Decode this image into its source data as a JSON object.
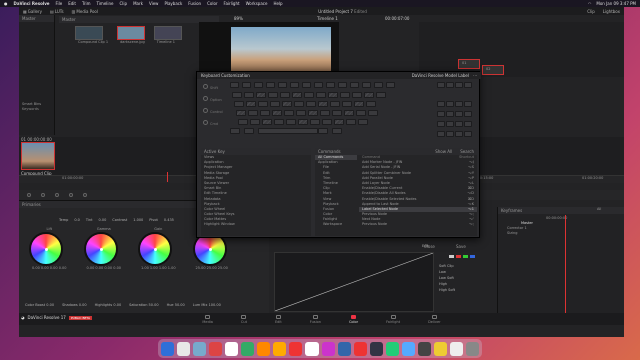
{
  "menubar": {
    "items": [
      "DaVinci Resolve",
      "File",
      "Edit",
      "Trim",
      "Timeline",
      "Clip",
      "Mark",
      "View",
      "Playback",
      "Fusion",
      "Color",
      "Fairlight",
      "Workspace",
      "Help"
    ],
    "clock": "Mon Jan 09 3:47 PM"
  },
  "toolbar": {
    "gallery": "Gallery",
    "luts": "LUTs",
    "media_pool": "Media Pool",
    "project_title": "Untitled Project 7",
    "edited": "Edited",
    "timeline": "Timeline 1",
    "timecode": "00:00:07:00",
    "clip": "Clip",
    "lightbox": "Lightbox",
    "effects": "Effects",
    "zoom": "89%"
  },
  "mediapool": {
    "bin": "Master",
    "clips": [
      "Compound Clip 1",
      "darkscene.jpg",
      "Timeline 1"
    ],
    "smart_bins": "Smart Bins",
    "keywords": "Keywords"
  },
  "clip": {
    "timecode": "00:00:00:00",
    "label": "Compound Clip",
    "index": "01"
  },
  "timeline_ruler": [
    "01:00:00:00",
    "01:00:05:00",
    "01:00:10:00",
    "01:00:15:00",
    "01:00:20:00"
  ],
  "nodes": {
    "node1": "01",
    "node2": "02"
  },
  "primaries": {
    "title": "Primaries",
    "temp_label": "Temp",
    "temp": "0.0",
    "tint_label": "Tint",
    "tint": "0.00",
    "contrast_label": "Contrast",
    "contrast": "1.000",
    "pivot_label": "Pivot",
    "pivot": "0.435",
    "wheels": [
      {
        "name": "Lift",
        "vals": "0.00 0.00 0.00 0.00"
      },
      {
        "name": "Gamma",
        "vals": "0.00 0.00 0.00 0.00"
      },
      {
        "name": "Gain",
        "vals": "1.00 1.00 1.00 1.00"
      },
      {
        "name": "Offset",
        "vals": "25.00 25.00 25.00"
      }
    ],
    "bottom": [
      {
        "l": "Color Boost",
        "v": "0.00"
      },
      {
        "l": "Shadows",
        "v": "0.00"
      },
      {
        "l": "Highlights",
        "v": "0.00"
      },
      {
        "l": "Saturation",
        "v": "50.00"
      },
      {
        "l": "Hue",
        "v": "50.00"
      },
      {
        "l": "Lum Mix",
        "v": "100.00"
      }
    ]
  },
  "keyframes": {
    "title": "Keyframes",
    "mode": "All",
    "master": "Master",
    "corrector": "Corrector 1",
    "sizing": "Sizing",
    "tc": "00:00:00:00"
  },
  "curves": {
    "edit": "Edit",
    "channels": [
      "Y",
      "R",
      "G",
      "B"
    ],
    "labels": [
      "Soft Clip",
      "Low",
      "Low Soft",
      "High",
      "High Soft"
    ]
  },
  "dialog": {
    "title": "Keyboard Customization",
    "preset": "DaVinci Resolve Model Label",
    "modifiers": [
      "Shift",
      "Option",
      "Control",
      "Cmd"
    ],
    "active_key_title": "Active Key",
    "active_key_col": "Commands",
    "active_keys": [
      "Views",
      "Application",
      "Project Manager",
      "Media Storage",
      "Media Pool",
      "Source Viewer",
      "Smart Bin",
      "Edit Timeline",
      "Metadata",
      "Playback",
      "Color Wheel",
      "Color Wheel Keys",
      "Color Mattes",
      "Highlight Window"
    ],
    "commands_title": "Commands",
    "commands_filter": "Show All",
    "commands_search": "Search",
    "tree": [
      "All Commands",
      "Application",
      "File",
      "Edit",
      "Trim",
      "Timeline",
      "Clip",
      "Mark",
      "View",
      "Playback",
      "Fusion",
      "Color",
      "Fairlight",
      "Workspace"
    ],
    "cmd_header": "Command",
    "shortcut_header": "Shortcut",
    "cmds": [
      {
        "c": "Add Marker Node - JFIN",
        "s": "⌥J"
      },
      {
        "c": "Add Serial Node - JFIN",
        "s": "⌥S"
      },
      {
        "c": "Add Splitter Combiner Node",
        "s": "⌥Y"
      },
      {
        "c": "Add Parallel Node",
        "s": "⌥P"
      },
      {
        "c": "Add Layer Node",
        "s": "⌥L"
      },
      {
        "c": "Enable/Disable Current",
        "s": "⌘D"
      },
      {
        "c": "Enable/Disable All Nodes",
        "s": "⌥D"
      },
      {
        "c": "Enable/Disable Selected Nodes",
        "s": "⌘D"
      },
      {
        "c": "Append to Last Node",
        "s": "⌥K"
      },
      {
        "c": "Label Selected Node",
        "s": "⌥1"
      },
      {
        "c": "Previous Node",
        "s": "⌥;"
      },
      {
        "c": "Next Node",
        "s": "⌥'"
      },
      {
        "c": "Previous Node",
        "s": "⌥;"
      }
    ],
    "close": "Close",
    "save": "Save"
  },
  "pages": [
    {
      "n": "Media",
      "a": false
    },
    {
      "n": "Cut",
      "a": false
    },
    {
      "n": "Edit",
      "a": false
    },
    {
      "n": "Fusion",
      "a": false
    },
    {
      "n": "Color",
      "a": true
    },
    {
      "n": "Fairlight",
      "a": false
    },
    {
      "n": "Deliver",
      "a": false
    }
  ],
  "brand": {
    "name": "DaVinci Resolve 17",
    "badge": "PUBLIC BETA"
  },
  "dock_colors": [
    "#2f6fd8",
    "#e8e8e8",
    "#7ac",
    "#d44",
    "#fff",
    "#3a6",
    "#f80",
    "#fa0",
    "#e33",
    "#fff",
    "#c3c",
    "#36a",
    "#e33",
    "#334",
    "#2c7",
    "#5af",
    "#444",
    "#ec3",
    "#eee",
    "#888"
  ]
}
